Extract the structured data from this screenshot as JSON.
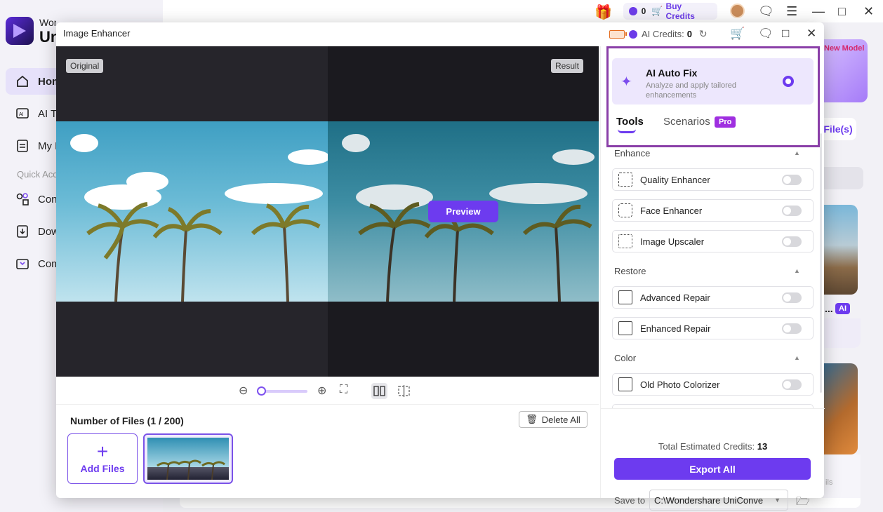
{
  "background": {
    "brand_line1": "Wondershare",
    "brand_line2": "UniConverter",
    "nav": [
      {
        "label": "Home"
      },
      {
        "label": "AI Tools"
      },
      {
        "label": "My Files"
      }
    ],
    "quick_access": "Quick Access",
    "quick": [
      {
        "label": "Converter"
      },
      {
        "label": "Downloader"
      },
      {
        "label": "Compressor"
      }
    ],
    "credits_count": "0",
    "buy_credits": "Buy Credits",
    "new_model": "New Model",
    "add_files_partial": "File(s)",
    "ai_badge": "AI",
    "dots": "...",
    "bottom_text": "ils"
  },
  "window": {
    "title": "Image Enhancer",
    "ai_credits_label": "AI Credits:",
    "ai_credits_value": "0"
  },
  "preview": {
    "original_tag": "Original",
    "result_tag": "Result",
    "preview_button": "Preview"
  },
  "files": {
    "count_label": "Number of Files (1 / 200)",
    "delete_all": "Delete All",
    "add_files": "Add Files"
  },
  "panel": {
    "autofix_title": "AI Auto Fix",
    "autofix_desc": "Analyze and apply tailored enhancements",
    "tab_tools": "Tools",
    "tab_scenarios": "Scenarios",
    "pro_badge": "Pro",
    "sections": {
      "enhance": "Enhance",
      "restore": "Restore",
      "color": "Color"
    },
    "tools": {
      "quality": "Quality Enhancer",
      "face": "Face Enhancer",
      "upscaler": "Image Upscaler",
      "advanced_repair": "Advanced Repair",
      "enhanced_repair": "Enhanced Repair",
      "colorizer": "Old Photo Colorizer"
    },
    "total_label": "Total Estimated Credits:",
    "total_value": "13",
    "export_all": "Export All",
    "save_to": "Save to",
    "save_path": "C:\\Wondershare UniConve"
  },
  "colors": {
    "accent": "#6d3bef",
    "highlight_border": "#8a3fa8"
  }
}
